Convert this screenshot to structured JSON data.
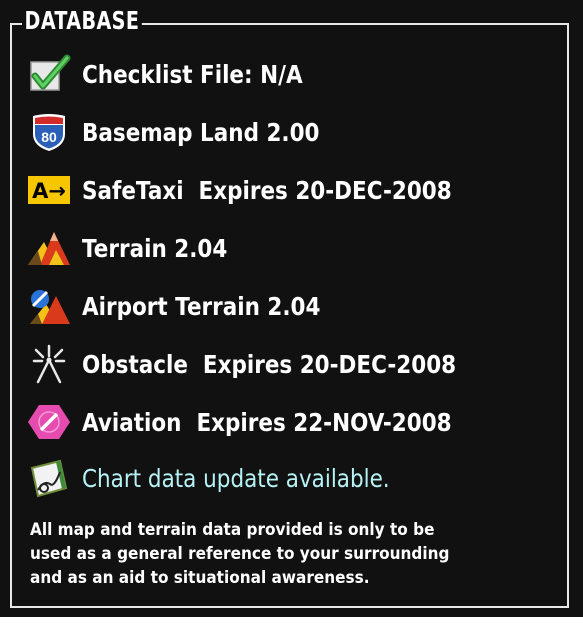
{
  "panel": {
    "title": "DATABASE",
    "items": [
      {
        "icon": "checkmark-icon",
        "label": "Checklist File: N/A"
      },
      {
        "icon": "interstate-shield-icon",
        "icon_text": "80",
        "label": "Basemap Land 2.00"
      },
      {
        "icon": "safetaxi-icon",
        "icon_text": "A→",
        "label": "SafeTaxi  Expires 20-DEC-2008"
      },
      {
        "icon": "terrain-icon",
        "label": "Terrain 2.04"
      },
      {
        "icon": "airport-terrain-icon",
        "label": "Airport Terrain 2.04"
      },
      {
        "icon": "obstacle-icon",
        "label": "Obstacle  Expires 20-DEC-2008"
      },
      {
        "icon": "aviation-icon",
        "label": "Aviation  Expires 22-NOV-2008"
      },
      {
        "icon": "chart-icon",
        "label": "Chart data update available."
      }
    ],
    "disclaimer": "All map and terrain data provided is only to be\nused as a general reference to your surrounding\nand as an aid to situational awareness."
  },
  "colors": {
    "background": "#111111",
    "text": "#ffffff",
    "notice_text": "#b6f1f4",
    "checkmark": "#43b649",
    "shield_blue": "#2a60b8",
    "shield_red": "#d32a2a",
    "safetaxi_yellow": "#f6c600",
    "aviation_magenta": "#e64bb0"
  }
}
